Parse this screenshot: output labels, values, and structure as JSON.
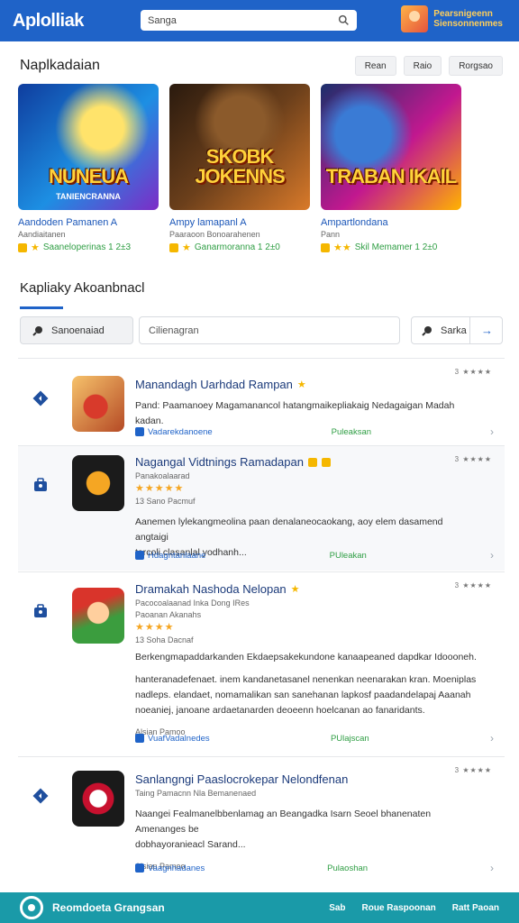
{
  "header": {
    "logo": "Aplolliak",
    "logo_sub": "",
    "search_placeholder": "Sanga",
    "user_line1": "Pearsnigeenn",
    "user_line2": "Siensonnenmes"
  },
  "featured": {
    "title": "Naplkadaian",
    "filters": [
      "Rean",
      "Raio",
      "Rorgsao"
    ],
    "cards": [
      {
        "art_title": "NUNEUA",
        "art_sub": "TANIENCRANNA",
        "name": "Aandoden Pamanen A",
        "developer": "Aandiaitanen",
        "meta": "Saaneloperinas 1 2±3"
      },
      {
        "art_title": "SKOBK JOKENNS",
        "art_sub": "",
        "name": "Ampy lamapanl A",
        "developer": "Paaraoon Bonoarahenen",
        "meta": "Ganarmoranna 1 2±0"
      },
      {
        "art_title": "TRABAN IKAIL",
        "art_sub": "",
        "name": "Ampartlondana",
        "developer": "Pann",
        "meta": "Skil Memamer 1 2±0"
      }
    ]
  },
  "list": {
    "title": "Kapliaky Akoanbnacl",
    "sort_label": "Sanoenaiad",
    "filter_placeholder": "Cilienagran",
    "go_label": "Sarka",
    "items": [
      {
        "title": "Manandagh Uarhdad Rampan",
        "lines": [
          "Pand: Paamanoey Magamanancol hatangmaikepliakaig Nedagaigan Madah",
          "kadan."
        ],
        "footer_left": "Vadarekdanoene",
        "footer_mid": "Puleaksan",
        "rating": "3 ★★★★"
      },
      {
        "title": "Nagangal Vidtnings Ramadapan",
        "sub": "Panakoalaarad",
        "stars": "★★★★★",
        "sub2": "13 Sano Pacmuf",
        "lines": [
          "Aanemen lylekangmeolina paan denalaneocaokang, aoy elem dasamend angtaigi",
          "tarcoli clasanlal yodhanh..."
        ],
        "footer_left": "Hdagntanlaane",
        "footer_mid": "PUleakan",
        "rating": "3 ★★★★"
      },
      {
        "title": "Dramakah Nashoda Nelopan",
        "sub": "Pacocoalaanad Inka Dong IRes",
        "sub_b": "Paoanan Akanahs",
        "stars": "★★★★",
        "sub2": "13 Soha Dacnaf",
        "lines": [
          "Berkengmapaddarkanden Ekdaepsakekundone kanaapeaned dapdkar Idoooneh.",
          "hanteranadefenaet. inem kandanetasanel nenenkan neenarakan kran. Moeniplas",
          "nadleps. elandaet, nomamalikan san sanehanan lapkosf paadandelapaj Aaanah",
          "noeaniej, janoane ardaetanarden deoeenn hoelcanan ao fanaridants."
        ],
        "extra": "Alsian Pamoo",
        "footer_left": "VuafVadalnedes",
        "footer_mid": "PUlajscan",
        "rating": "3 ★★★★"
      },
      {
        "title": "Sanlangngi Paaslocrokepar Nelondfenan",
        "sub": "Taing Pamacnn Nla Bemanenaed",
        "lines": [
          "Naangei Fealmanelbbenlamag an Beangadka Isarn Seoel bhanenaten Amenanges be",
          "dobhayoranieacl Sarand..."
        ],
        "extra": "Alsian Pamoo",
        "footer_left": "Vaagnhadanes",
        "footer_mid": "Pulaoshan",
        "rating": "3 ★★★★"
      }
    ]
  },
  "bottom": {
    "brand": "Reomdoeta Grangsan",
    "link1": "Sab",
    "link2": "Roue Raspoonan",
    "link3": "Ratt Paoan"
  }
}
